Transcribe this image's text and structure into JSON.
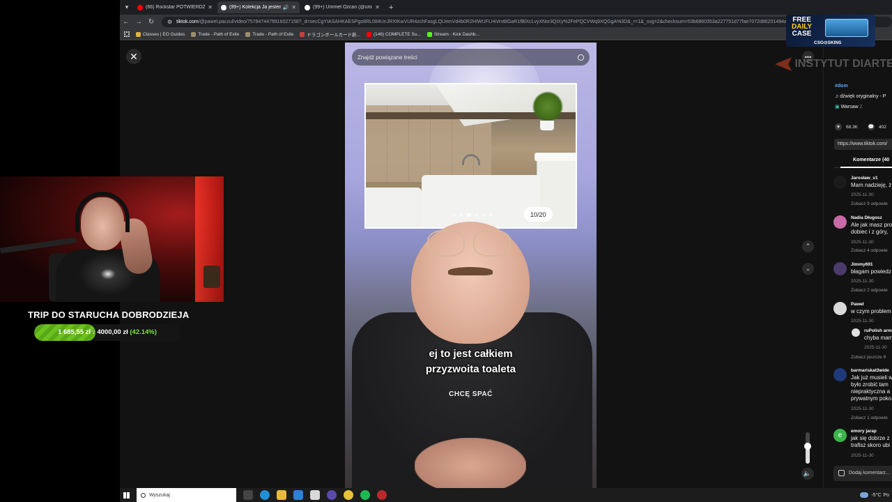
{
  "browser": {
    "tabs": [
      {
        "title": "(66) Rockstar POTWIERDZIŁ W...",
        "color": "#ff0000",
        "active": false
      },
      {
        "title": "(99+) Kolekcja Ja jestem Do...",
        "color": "#ffffff",
        "active": true
      },
      {
        "title": "(99+) Ummet Ozcan (@ummet...",
        "color": "#ffffff",
        "active": false
      }
    ],
    "url_host": "tiktok.com",
    "url_path": "/@pawel.paczul/video/7578474479916027158?_d=secCgYIASAHKAESPgo8RL084UnJRXIKwVUR4zchFasgLQUemVd4b0R2HIWUFLHiVrnt8GaR1fBlXcLvyXNsr3QIXy%2FePQCVWq9XQGgA%3D&_r=1&_svg=2&checksum=53b6860353a227751d77fae7072d86201494ac84bb0824",
    "bookmarks": [
      {
        "label": "Classes | EO Guides",
        "color": "#e2b33b"
      },
      {
        "label": "Trade - Path of Exile",
        "color": "#9b8c6a"
      },
      {
        "label": "Trade - Path of Exile",
        "color": "#9b8c6a"
      },
      {
        "label": "ドラゴンボールカード新...",
        "color": "#d23c3c"
      },
      {
        "label": "(146) COMPLETE Su...",
        "color": "#ff0000"
      },
      {
        "label": "Stream - Kick Dashb...",
        "color": "#53fc18"
      }
    ]
  },
  "video": {
    "search_placeholder": "Znajdź powiązane treści",
    "photo_counter": "10/20",
    "photo_index": 10,
    "photo_total": 20,
    "caption_line1": "ej to jest całkiem",
    "caption_line2": "przyzwoita toaleta",
    "shirt_text": "CHCĘ SPAĆ"
  },
  "ad": {
    "line1": "FREE",
    "line2": "DAILY",
    "line3": "CASE",
    "brand": "CSG⊙SKINS"
  },
  "watermark": "INSTYTUT DIARTE",
  "sidebar": {
    "hashtag": "#dom",
    "sound": "dźwięk oryginalny - P",
    "location": "Warsaw",
    "location_count": "2",
    "likes": "68.3K",
    "comments_count": "402",
    "link": "https://www.tiktok.com/",
    "comments_tab": "Komentarze (40",
    "comments": [
      {
        "user": "Jarosław_v1",
        "text": [
          "Mam nadzieję, ż"
        ],
        "date": "2025-11-30",
        "more": "Zobacz 9 odpowie",
        "avatar": "#1b1b1b"
      },
      {
        "user": "Nadia Długosz",
        "text": [
          "Ale jak masz pro",
          "dobiec i z góry,"
        ],
        "date": "2025-11-30",
        "more": "Zobacz 4 odpowie",
        "avatar": "#c86aa5"
      },
      {
        "user": "Jimmy691",
        "text": [
          "błagam powiedz"
        ],
        "date": "2025-11-30",
        "more": "Zobacz 2 odpowie",
        "avatar": "#4b3b6a"
      },
      {
        "user": "Paweł",
        "text": [
          "w czym problem"
        ],
        "date": "2025-11-30",
        "more": "",
        "avatar": "#d9d9d9"
      },
      {
        "user": "barmariskat3wide",
        "text": [
          "Jak już musieli w",
          "było zrobić tam",
          "niepraktyczna a",
          "prywatnym poko"
        ],
        "date": "2025-11-30",
        "more": "Zobacz 1 odpowie",
        "avatar": "#1f3a7a"
      },
      {
        "user": "emory jarap",
        "text": [
          "jak się dobrze z",
          "trafisz skoro ubi"
        ],
        "date": "2025-11-30",
        "more": "",
        "avatar": "#3bb54a"
      }
    ],
    "reply": {
      "user": "ruPolish arm",
      "text": "chyba mam",
      "date": "2025-11-30",
      "more": "Zobacz jeszcze 9"
    },
    "add_comment": "Dodaj komentarz..."
  },
  "stream_overlay": {
    "goal_title": "TRIP DO STARUCHA DOBRODZIEJA",
    "goal_current": "1 685,55 zł",
    "goal_sep": "z",
    "goal_target": "4000,00 zł",
    "goal_percent": "(42.14%)",
    "goal_fraction": 0.4214
  },
  "taskbar": {
    "search_placeholder": "Wyszukaj",
    "weather": "-5°C",
    "weather_extra": "Po"
  },
  "volume_level": 0.55
}
